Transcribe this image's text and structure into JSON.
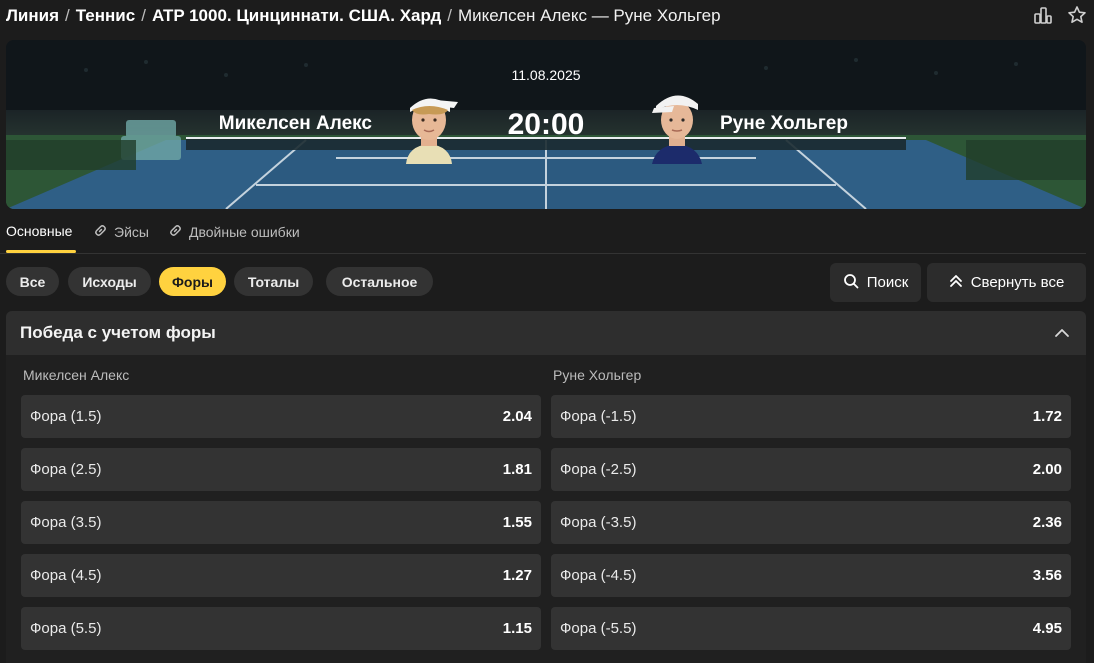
{
  "breadcrumb": {
    "items": [
      "Линия",
      "Теннис",
      "ATP 1000. Цинциннати. США. Хард",
      "Микелсен Алекс — Руне Хольгер"
    ],
    "separator": "/"
  },
  "top_icons": [
    "share-icon",
    "star-icon"
  ],
  "match": {
    "date": "11.08.2025",
    "time": "20:00",
    "player1": "Микелсен Алекс",
    "player2": "Руне Хольгер"
  },
  "tabs": [
    {
      "label": "Основные",
      "active": true
    },
    {
      "label": "Эйсы",
      "icon": "link-icon"
    },
    {
      "label": "Двойные ошибки",
      "icon": "link-icon"
    }
  ],
  "filters": [
    {
      "label": "Все"
    },
    {
      "label": "Исходы"
    },
    {
      "label": "Форы",
      "active": true
    },
    {
      "label": "Тоталы"
    },
    {
      "label": "Остальное"
    }
  ],
  "actions": {
    "search_label": "Поиск",
    "collapse_label": "Свернуть все"
  },
  "market": {
    "title": "Победа с учетом форы",
    "left_label": "Микелсен Алекс",
    "right_label": "Руне Хольгер",
    "left": [
      {
        "label": "Фора (1.5)",
        "odds": "2.04"
      },
      {
        "label": "Фора (2.5)",
        "odds": "1.81"
      },
      {
        "label": "Фора (3.5)",
        "odds": "1.55"
      },
      {
        "label": "Фора (4.5)",
        "odds": "1.27"
      },
      {
        "label": "Фора (5.5)",
        "odds": "1.15"
      }
    ],
    "right": [
      {
        "label": "Фора (-1.5)",
        "odds": "1.72"
      },
      {
        "label": "Фора (-2.5)",
        "odds": "2.00"
      },
      {
        "label": "Фора (-3.5)",
        "odds": "2.36"
      },
      {
        "label": "Фора (-4.5)",
        "odds": "3.56"
      },
      {
        "label": "Фора (-5.5)",
        "odds": "4.95"
      }
    ]
  },
  "colors": {
    "accent": "#ffd23f",
    "background": "#1c1c1c",
    "panel": "#333333"
  }
}
